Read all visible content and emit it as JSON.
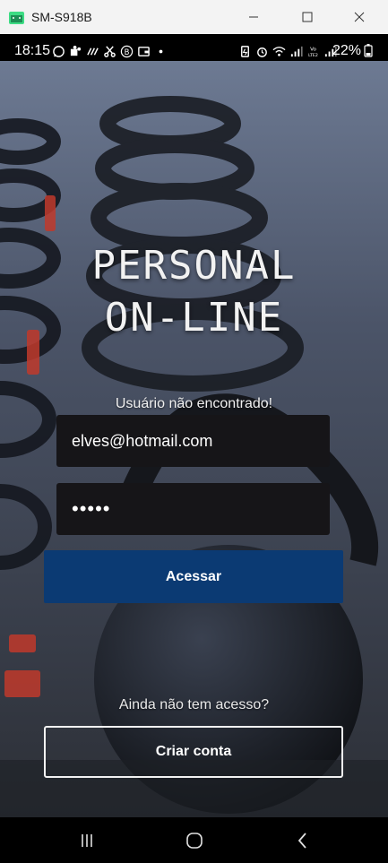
{
  "window": {
    "title": "SM-S918B"
  },
  "statusbar": {
    "time": "18:15",
    "battery": "22%",
    "left_icons": [
      "whatsapp-icon",
      "teams-icon",
      "signal-waves-icon",
      "scissors-icon",
      "b-circle-icon",
      "wallet-icon",
      "dot-icon"
    ],
    "right_icons": [
      "battery-saver-icon",
      "alarm-icon",
      "wifi-icon",
      "signal-icon",
      "volte-icon",
      "signal-icon",
      "battery-icon"
    ]
  },
  "app": {
    "title_line1": "PERSONAL",
    "title_line2": "ON-LINE",
    "error_message": "Usuário não encontrado!",
    "email_value": "elves@hotmail.com",
    "password_value": "•••••",
    "login_button": "Acessar",
    "no_access_text": "Ainda não tem acesso?",
    "create_account_button": "Criar conta"
  },
  "colors": {
    "primary_button": "#0b3a73",
    "input_background": "#161518",
    "kettlebell_accent": "#c0392b"
  },
  "navbar": {
    "buttons": [
      "recents-icon",
      "home-icon",
      "back-icon"
    ]
  }
}
